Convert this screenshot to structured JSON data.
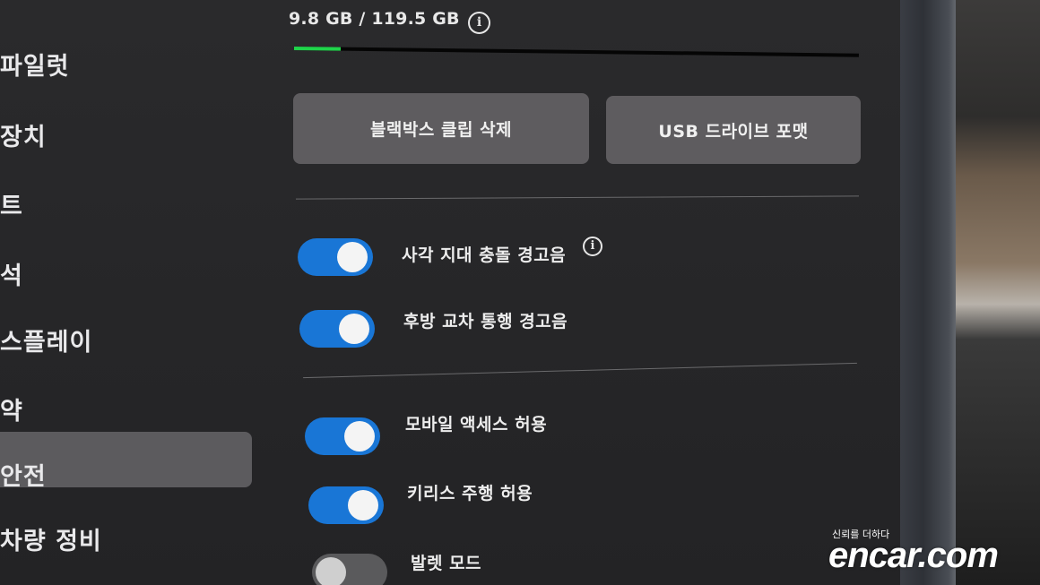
{
  "sidebar": {
    "items": [
      {
        "label": "파일럿"
      },
      {
        "label": "장치"
      },
      {
        "label": "트"
      },
      {
        "label": "석"
      },
      {
        "label": "스플레이"
      },
      {
        "label": "약"
      },
      {
        "label": "안전"
      },
      {
        "label": "차량 정비"
      }
    ],
    "active_index": 6
  },
  "storage": {
    "text": "9.8 GB / 119.5 GB",
    "used_fraction": 0.082,
    "info_icon": "info-icon",
    "bar_color": "#1fd44a"
  },
  "buttons": {
    "delete_clips": "블랙박스 클립 삭제",
    "format_usb": "USB 드라이브 포맷"
  },
  "settings": {
    "blindspot_chime": {
      "label": "사각 지대 충돌 경고음",
      "enabled": true
    },
    "rear_cross_traffic_chime": {
      "label": "후방 교차 통행 경고음",
      "enabled": true
    },
    "mobile_access": {
      "label": "모바일 액세스 허용",
      "enabled": true
    },
    "keyless_driving": {
      "label": "키리스 주행 허용",
      "enabled": true
    },
    "valet_mode": {
      "label": "발렛 모드",
      "enabled": false
    }
  },
  "colors": {
    "toggle_on": "#1976d6",
    "toggle_off": "#5a5a5c",
    "background": "#262628"
  },
  "watermark": {
    "tagline": "신뢰를 더하다",
    "logo": "encar.com"
  }
}
